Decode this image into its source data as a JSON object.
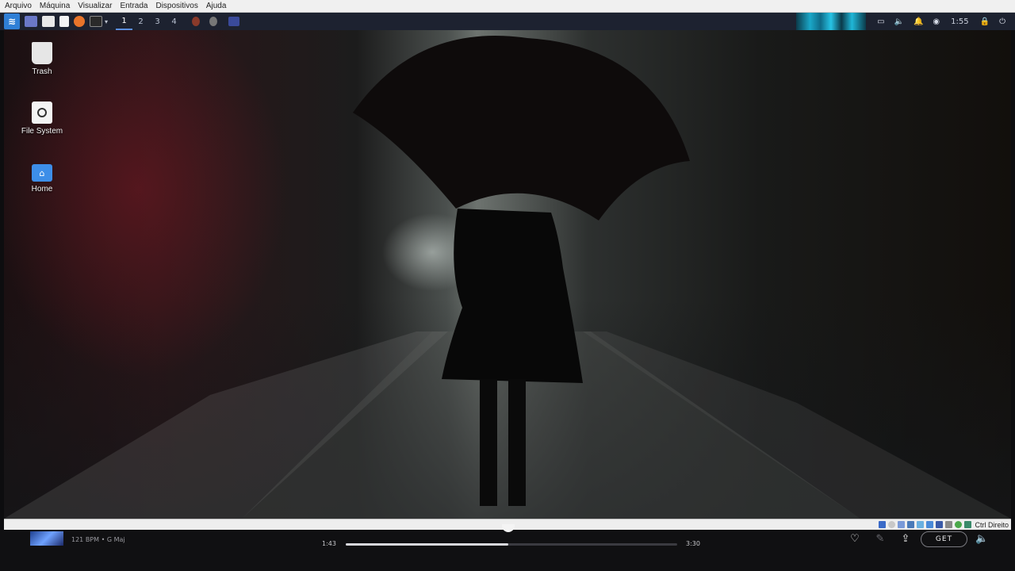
{
  "vm_menu": [
    "Arquivo",
    "Máquina",
    "Visualizar",
    "Entrada",
    "Dispositivos",
    "Ajuda"
  ],
  "panel": {
    "workspaces": [
      "1",
      "2",
      "3",
      "4"
    ],
    "active_workspace_index": 0,
    "clock": "1:55",
    "menu_icon": "xfce-menu-icon",
    "launchers": [
      {
        "name": "desktop-icon",
        "color": "#6a78c8"
      },
      {
        "name": "files-icon",
        "color": "#e8e8e8"
      },
      {
        "name": "document-icon",
        "color": "#f4f4f4"
      },
      {
        "name": "firefox-icon",
        "color": "#e8742a"
      },
      {
        "name": "terminal-icon",
        "color": "#2a2a2a"
      }
    ],
    "tray_icons": [
      "display-icon",
      "volume-icon",
      "notification-bell-icon",
      "network-icon"
    ],
    "end_icons": [
      "lock-icon",
      "logout-icon"
    ]
  },
  "desktop": {
    "icons": [
      {
        "label": "Trash",
        "icon": "trash-icon"
      },
      {
        "label": "File System",
        "icon": "drive-icon"
      },
      {
        "label": "Home",
        "icon": "home-folder-icon"
      }
    ]
  },
  "vm_status": {
    "host_key": "Ctrl Direito",
    "icons": [
      "hdd-icon",
      "optical-icon",
      "audio-icon",
      "network-icon",
      "usb-icon",
      "shared-folder-icon",
      "display-icon",
      "recording-icon",
      "cpu-icon",
      "mouse-icon"
    ]
  },
  "player": {
    "meta": "121 BPM • G Maj",
    "elapsed": "1:43",
    "total": "3:30",
    "progress": 0.49,
    "get_label": "GET",
    "icons": [
      "like-heart-icon",
      "edit-icon",
      "share-icon",
      "volume-icon"
    ]
  }
}
